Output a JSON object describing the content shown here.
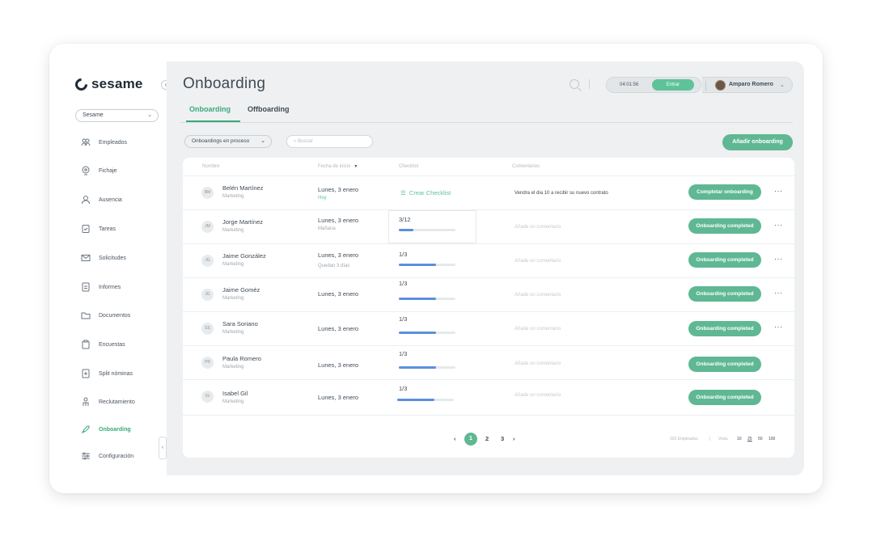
{
  "brand": {
    "name": "sesame"
  },
  "sidebar": {
    "company": "Sesame",
    "items": [
      {
        "label": "Empleados",
        "icon": "people-icon"
      },
      {
        "label": "Fichaje",
        "icon": "location-icon"
      },
      {
        "label": "Ausencia",
        "icon": "person-icon"
      },
      {
        "label": "Tareas",
        "icon": "tasks-icon"
      },
      {
        "label": "Solicitudes",
        "icon": "mail-icon"
      },
      {
        "label": "Informes",
        "icon": "report-icon"
      },
      {
        "label": "Documentos",
        "icon": "folder-icon"
      },
      {
        "label": "Encuestas",
        "icon": "clipboard-icon"
      },
      {
        "label": "Split nóminas",
        "icon": "split-icon"
      },
      {
        "label": "Reclutamiento",
        "icon": "recruit-icon"
      },
      {
        "label": "Onboarding",
        "icon": "rocket-icon",
        "active": true
      },
      {
        "label": "Configuración",
        "icon": "settings-icon"
      }
    ]
  },
  "header": {
    "title": "Onboarding",
    "clock": "04:01:56",
    "enter_label": "Entrar",
    "user_name": "Amparo Romero"
  },
  "tabs": {
    "active": "Onboarding",
    "other": "Offboarding"
  },
  "toolbar": {
    "filter": "Onboardings en proceso",
    "search_placeholder": "Buscar",
    "add_button": "Añadir onboarding"
  },
  "table": {
    "columns": {
      "name": "Nombre",
      "start_date": "Fecha de inicio",
      "checklist": "Checklist",
      "comments": "Comentarios"
    },
    "rows": [
      {
        "initials": "BM",
        "name": "Belén Martínez",
        "dept": "Marketing",
        "date": "Lunes, 3 enero",
        "date_sub": "Hoy",
        "checklist_action": "Crear Checklist",
        "comment": "Vendra el dia 10 a recibir su nuevo contrato",
        "status": "Completar onboarding"
      },
      {
        "initials": "JM",
        "name": "Jorge Martínez",
        "dept": "Marketing",
        "date": "Lunes, 3 enero",
        "date_sub": "Mañana",
        "progress": "3/12",
        "progress_value": 0.25,
        "comment": "Añade un comentario",
        "status": "Onboarding completed"
      },
      {
        "initials": "JG",
        "name": "Jaime González",
        "dept": "Marketing",
        "date": "Lunes, 3 enero",
        "date_sub": "Quedan 3 días",
        "progress": "1/3",
        "progress_value": 0.65,
        "comment": "Añade un comentario",
        "status": "Onboarding completed"
      },
      {
        "initials": "JG",
        "name": "Jaime Goméz",
        "dept": "Marketing",
        "date": "Lunes, 3 enero",
        "progress": "1/3",
        "progress_value": 0.65,
        "comment": "Añade un comentario",
        "status": "Onboarding completed"
      },
      {
        "initials": "SS",
        "name": "Sara Soriano",
        "dept": "Marketing",
        "date": "Lunes, 3 enero",
        "progress": "1/3",
        "progress_value": 0.65,
        "comment": "Añade un comentario",
        "status": "Onboarding completed"
      },
      {
        "initials": "PR",
        "name": "Paula Romero",
        "dept": "Marketing",
        "date": "Lunes, 3 enero",
        "progress": "1/3",
        "progress_value": 0.65,
        "comment": "Añade un comentario",
        "status": "Onboarding completed"
      },
      {
        "initials": "IG",
        "name": "Isabel Gil",
        "dept": "Marketing",
        "date": "Lunes, 3 enero",
        "progress": "1/3",
        "progress_value": 0.65,
        "comment": "Añade un comentario",
        "status": "Onboarding completed"
      }
    ]
  },
  "pagination": {
    "pages": [
      "1",
      "2",
      "3"
    ],
    "current": "1",
    "total": "320 Empleados",
    "view_label": "Vista:",
    "sizes": [
      "10",
      "25",
      "50",
      "100"
    ],
    "selected_size": "25"
  },
  "colors": {
    "accent": "#5fb893",
    "progress": "#5b8fe0",
    "background": "#eef0f1"
  }
}
